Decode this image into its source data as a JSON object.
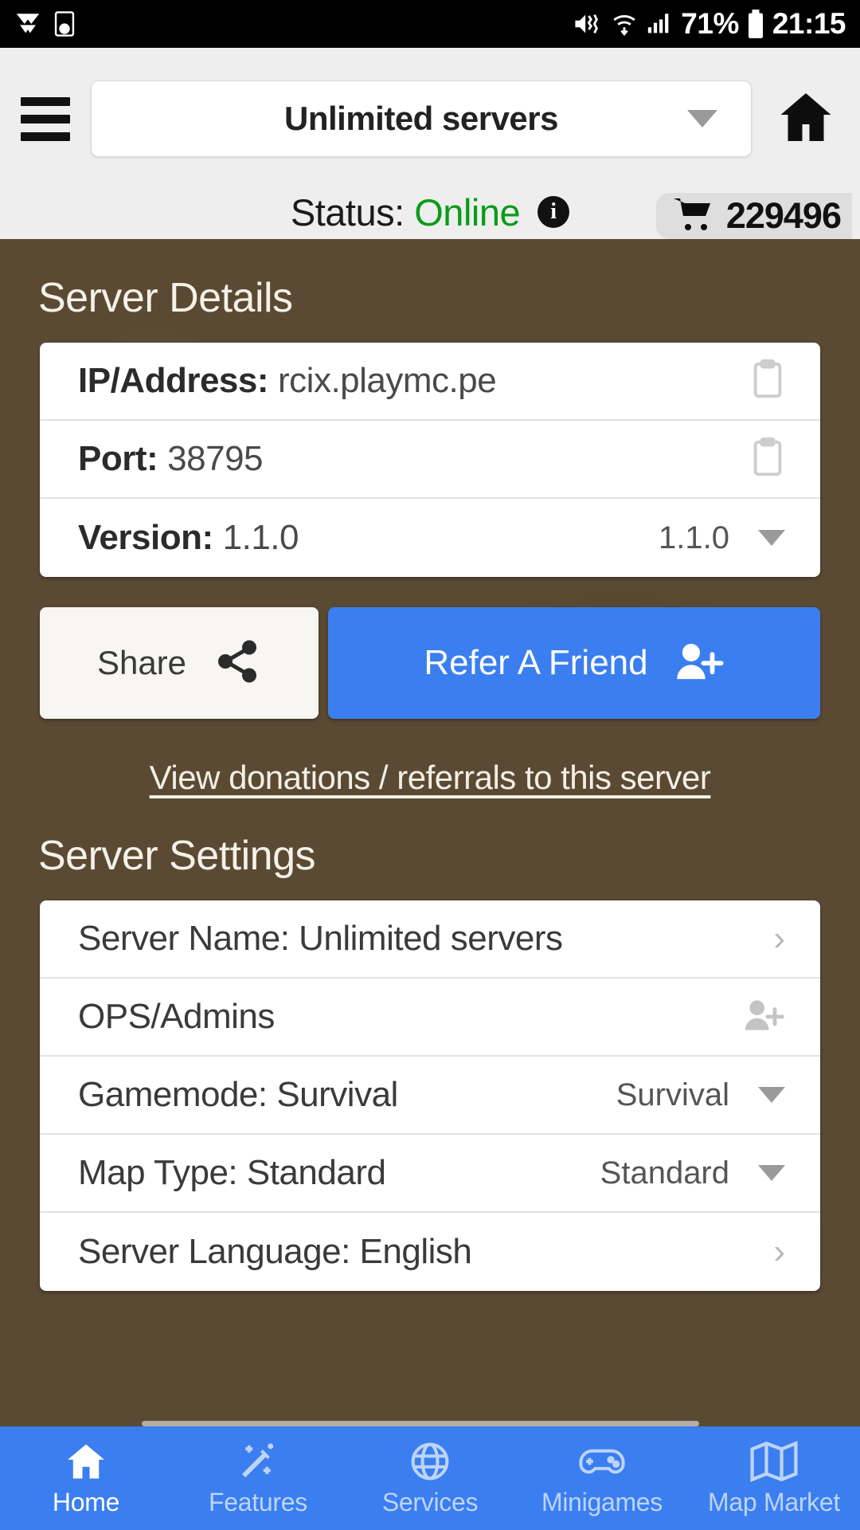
{
  "statusbar": {
    "icons_left": [
      "app-notification-icon",
      "device-clock-icon"
    ],
    "icons_right": [
      "mute-vibrate-icon",
      "wifi-icon",
      "cellular-signal-icon"
    ],
    "battery_percent": "71%",
    "time": "21:15"
  },
  "header": {
    "menu_icon": "hamburger-menu-icon",
    "server_name": "Unlimited servers",
    "dropdown_icon": "chevron-down-icon",
    "home_icon": "home-icon"
  },
  "status": {
    "label": "Status:",
    "value": "Online",
    "value_color": "#0a9b18",
    "info_icon": "info-icon",
    "info_glyph": "i",
    "cart_icon": "shopping-cart-icon",
    "cart_count": "229496"
  },
  "details": {
    "title": "Server Details",
    "rows": [
      {
        "key": "IP/Address:",
        "value": "rcix.playmc.pe",
        "action": "copy-icon"
      },
      {
        "key": "Port:",
        "value": "38795",
        "action": "copy-icon"
      },
      {
        "key": "Version:",
        "value": "1.1.0",
        "spinner_value": "1.1.0",
        "action": "dropdown-caret"
      }
    ]
  },
  "actions": {
    "share_label": "Share",
    "share_icon": "share-icon",
    "refer_label": "Refer A Friend",
    "refer_icon": "add-person-icon",
    "refer_color": "#3b7ef0",
    "donations_link": "View donations / referrals to this server"
  },
  "settings": {
    "title": "Server Settings",
    "rows": [
      {
        "label": "Server Name: Unlimited servers",
        "action": "chevron-right",
        "glyph": "›"
      },
      {
        "label": "OPS/Admins",
        "action": "add-person-icon",
        "glyph": ""
      },
      {
        "label": "Gamemode: Survival",
        "spinner_value": "Survival",
        "action": "dropdown-caret",
        "glyph": ""
      },
      {
        "label": "Map Type: Standard",
        "spinner_value": "Standard",
        "action": "dropdown-caret",
        "glyph": ""
      },
      {
        "label": "Server Language: English",
        "action": "chevron-right",
        "glyph": "›"
      }
    ]
  },
  "bottomnav": {
    "accent": "#3b7ef0",
    "items": [
      {
        "label": "Home",
        "icon": "home-icon",
        "active": true
      },
      {
        "label": "Features",
        "icon": "magic-wand-icon",
        "active": false
      },
      {
        "label": "Services",
        "icon": "globe-icon",
        "active": false
      },
      {
        "label": "Minigames",
        "icon": "gamepad-icon",
        "active": false
      },
      {
        "label": "Map Market",
        "icon": "map-icon",
        "active": false
      }
    ]
  }
}
